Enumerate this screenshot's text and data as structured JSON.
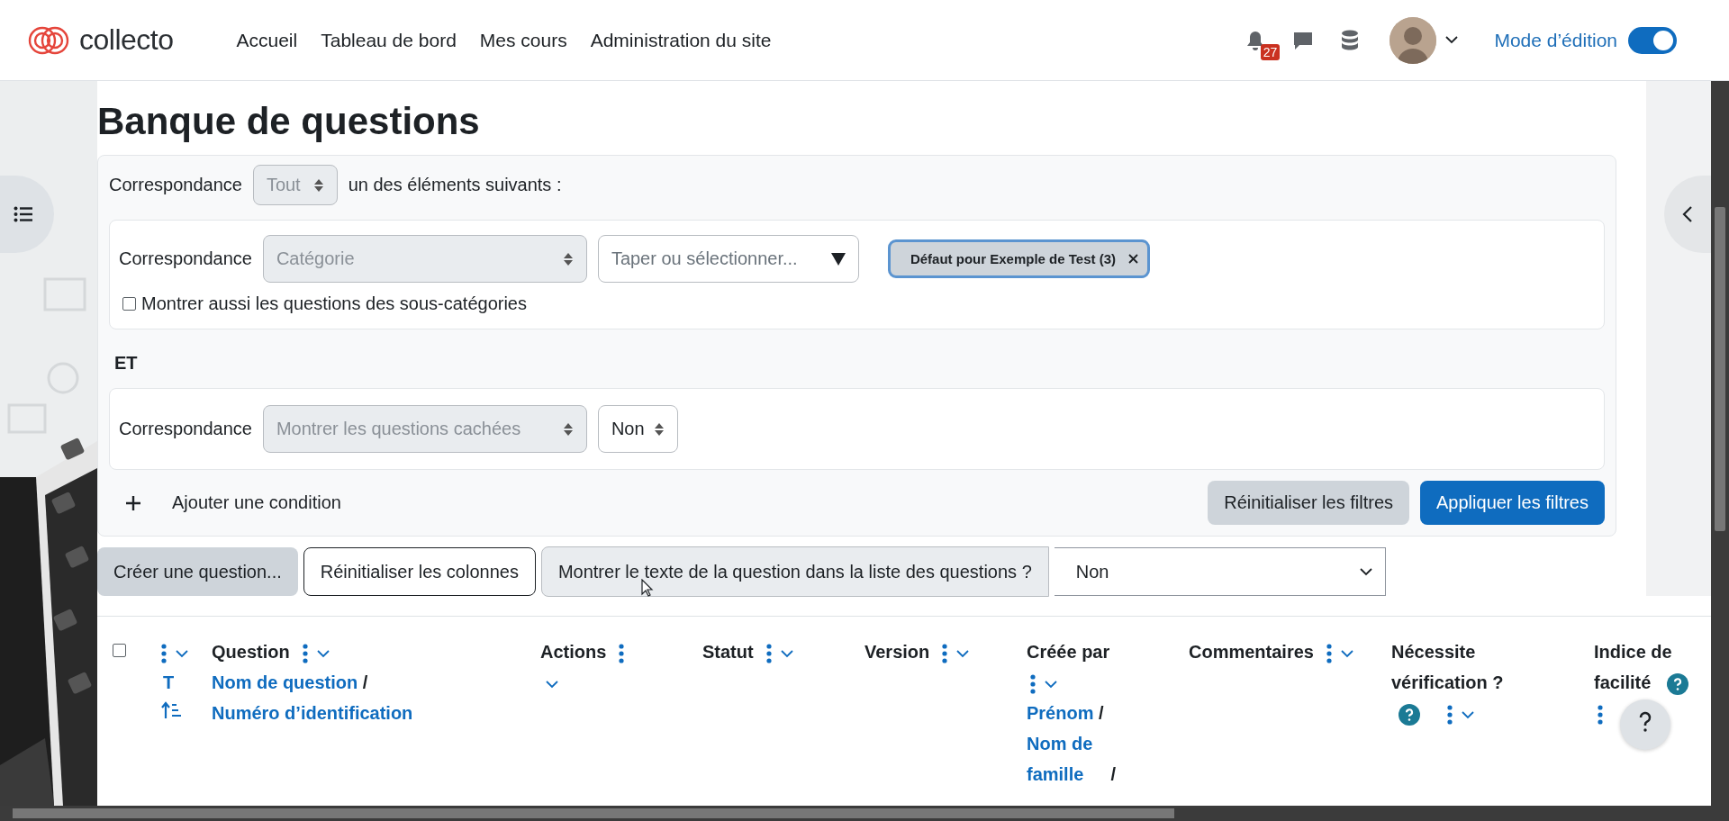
{
  "navbar": {
    "logo_text": "collecto",
    "nav_items": [
      "Accueil",
      "Tableau de bord",
      "Mes cours",
      "Administration du site"
    ],
    "notification_count": "27",
    "edit_mode": {
      "label": "Mode d’édition",
      "on": true
    }
  },
  "page_title": "Banque de questions",
  "filters": {
    "match_label": "Correspondance",
    "match_value": "Tout",
    "match_suffix": "un des éléments suivants :",
    "conditions": [
      {
        "kind": "category",
        "label": "Correspondance",
        "field": "Catégorie",
        "search_placeholder": "Taper ou sélectionner...",
        "chips": [
          "Défaut pour Exemple de Test (3)"
        ],
        "checkbox": {
          "label": "Montrer aussi les questions des sous-catégories",
          "checked": false
        }
      },
      {
        "kind": "joiner",
        "label": "ET"
      },
      {
        "kind": "select",
        "label": "Correspondance",
        "field": "Montrer les questions cachées",
        "value": "Non"
      }
    ],
    "add_condition": "Ajouter une condition",
    "reset_button": "Réinitialiser les filtres",
    "apply_button": "Appliquer les filtres"
  },
  "toolbar": {
    "create_button": "Créer une question...",
    "reset_columns_button": "Réinitialiser les colonnes",
    "show_text_label": "Montrer le texte de la question dans la liste des questions ?",
    "show_text_value": "Non"
  },
  "table": {
    "select_all_checked": false,
    "columns": [
      {
        "kind": "type",
        "sort_label": "T"
      },
      {
        "kind": "text",
        "title": "Question",
        "links": [
          {
            "kind": "link",
            "text": "Nom de question"
          },
          {
            "kind": "separator",
            "text": "/"
          },
          {
            "kind": "link",
            "text": "Numéro d’identification"
          }
        ]
      },
      {
        "kind": "text",
        "title": "Actions"
      },
      {
        "kind": "text",
        "title": "Statut"
      },
      {
        "kind": "text",
        "title": "Version"
      },
      {
        "kind": "text",
        "title": "Créée par",
        "links": [
          {
            "kind": "link",
            "text": "Prénom"
          },
          {
            "kind": "separator",
            "text": "/"
          },
          {
            "kind": "link",
            "text": "Nom de famille"
          },
          {
            "kind": "separator",
            "text": "/"
          }
        ]
      },
      {
        "kind": "text",
        "title": "Commentaires"
      },
      {
        "kind": "text",
        "title": "Nécessite vérification ?",
        "help": true,
        "help_below": true
      },
      {
        "kind": "text",
        "title": "Indice de facilité",
        "help": true
      }
    ]
  }
}
